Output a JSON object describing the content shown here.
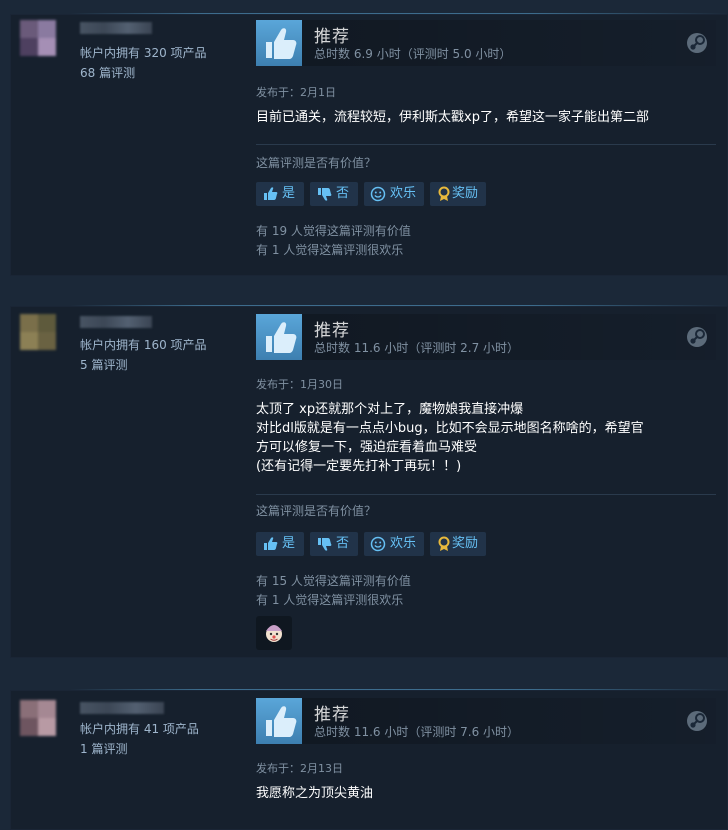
{
  "reviews": [
    {
      "author": {
        "products": "帐户内拥有 320 项产品",
        "reviews": "68 篇评测",
        "avatar_colors": [
          "#6a5a7a",
          "#8a7aa0",
          "#4e4060",
          "#a58fb5"
        ]
      },
      "recommendation": "推荐",
      "hours": "总时数 6.9 小时（评测时 5.0 小时）",
      "posted": "发布于：2月1日",
      "text": [
        "目前已通关，流程较短，伊利斯太戳xp了，希望这一家子能出第二部"
      ],
      "helpful_question": "这篇评测是否有价值？",
      "buttons": {
        "yes": "是",
        "no": "否",
        "funny": "欢乐",
        "award": "奖励"
      },
      "stats": [
        "有 19 人觉得这篇评测有价值",
        "有 1 人觉得这篇评测很欢乐"
      ],
      "reactions": []
    },
    {
      "author": {
        "products": "帐户内拥有 160 项产品",
        "reviews": "5 篇评测",
        "avatar_colors": [
          "#7a6f4a",
          "#5e5a3c",
          "#8c8055",
          "#6a6242"
        ]
      },
      "recommendation": "推荐",
      "hours": "总时数 11.6 小时（评测时 2.7 小时）",
      "posted": "发布于：1月30日",
      "text": [
        "太顶了 xp还就那个对上了，魔物娘我直接冲爆",
        "对比dl版就是有一点点小bug，比如不会显示地图名称啥的，希望官",
        "方可以修复一下，强迫症看着血马难受",
        "(还有记得一定要先打补丁再玩！！)"
      ],
      "helpful_question": "这篇评测是否有价值？",
      "buttons": {
        "yes": "是",
        "no": "否",
        "funny": "欢乐",
        "award": "奖励"
      },
      "stats": [
        "有 15 人觉得这篇评测有价值",
        "有 1 人觉得这篇评测很欢乐"
      ],
      "reactions": [
        "clown-face-award-icon"
      ]
    },
    {
      "author": {
        "products": "帐户内拥有 41 项产品",
        "reviews": "1 篇评测",
        "avatar_colors": [
          "#8a6f78",
          "#a58893",
          "#6e5560",
          "#b89aa4"
        ]
      },
      "recommendation": "推荐",
      "hours": "总时数 11.6 小时（评测时 7.6 小时）",
      "posted": "发布于：2月13日",
      "text": [
        "我愿称之为顶尖黄油"
      ]
    }
  ],
  "colors": {
    "accent": "#66c0f4",
    "background": "#1b2838",
    "card": "#16202d",
    "thumb": "#4c8fc0"
  }
}
